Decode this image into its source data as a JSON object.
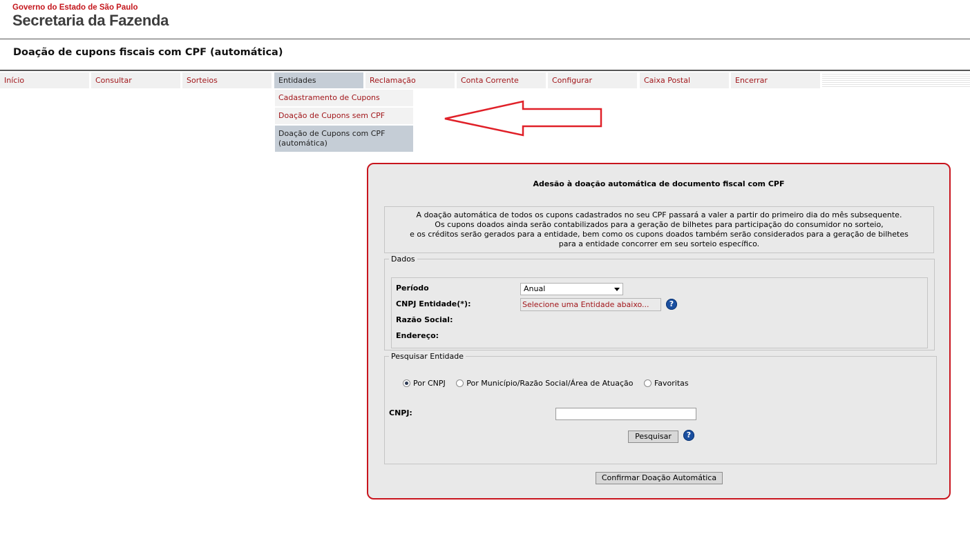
{
  "header": {
    "brand_top": "Governo do Estado de São Paulo",
    "brand_main": "Secretaria da Fazenda",
    "page_title": "Doação de cupons fiscais com CPF (automática)"
  },
  "menu": {
    "items": [
      {
        "label": "Início"
      },
      {
        "label": "Consultar"
      },
      {
        "label": "Sorteios"
      },
      {
        "label": "Entidades"
      },
      {
        "label": "Reclamação"
      },
      {
        "label": "Conta Corrente"
      },
      {
        "label": "Configurar"
      },
      {
        "label": "Caixa Postal"
      },
      {
        "label": "Encerrar"
      }
    ],
    "active_index": 3,
    "submenu": [
      {
        "label": "Cadastramento de Cupons"
      },
      {
        "label": "Doação de Cupons sem CPF"
      },
      {
        "label": "Doação de Cupons com CPF (automática)"
      }
    ]
  },
  "panel": {
    "title": "Adesão à doação automática de documento fiscal com CPF",
    "info_lines": [
      "A doação automática de todos os cupons cadastrados no seu CPF passará a valer a partir do primeiro dia do mês subsequente.",
      "Os cupons doados ainda serão contabilizados para a geração de bilhetes para participação do consumidor no sorteio,",
      "e os créditos serão gerados para a entidade, bem como os cupons doados também serão considerados para a geração de bilhetes",
      "para a entidade concorrer em seu sorteio específico."
    ],
    "dados": {
      "legend": "Dados",
      "periodo_label": "Período",
      "periodo_value": "Anual",
      "cnpj_entidade_label": "CNPJ Entidade(*):",
      "entidade_button": "Selecione uma Entidade abaixo...",
      "razao_social_label": "Razão Social:",
      "endereco_label": "Endereço:"
    },
    "pesquisar": {
      "legend": "Pesquisar Entidade",
      "radios": [
        {
          "label": "Por CNPJ",
          "checked": true
        },
        {
          "label": "Por Município/Razão Social/Área de Atuação",
          "checked": false
        },
        {
          "label": "Favoritas",
          "checked": false
        }
      ],
      "cnpj_label": "CNPJ:",
      "cnpj_value": "",
      "search_button": "Pesquisar"
    },
    "confirm_button": "Confirmar Doação Automática"
  },
  "icons": {
    "help": "question-mark-icon",
    "arrow": "left-arrow-annotation"
  },
  "colors": {
    "accent_red": "#a1161a",
    "border_red": "#c8141d",
    "menu_active": "#c5cdd6"
  }
}
